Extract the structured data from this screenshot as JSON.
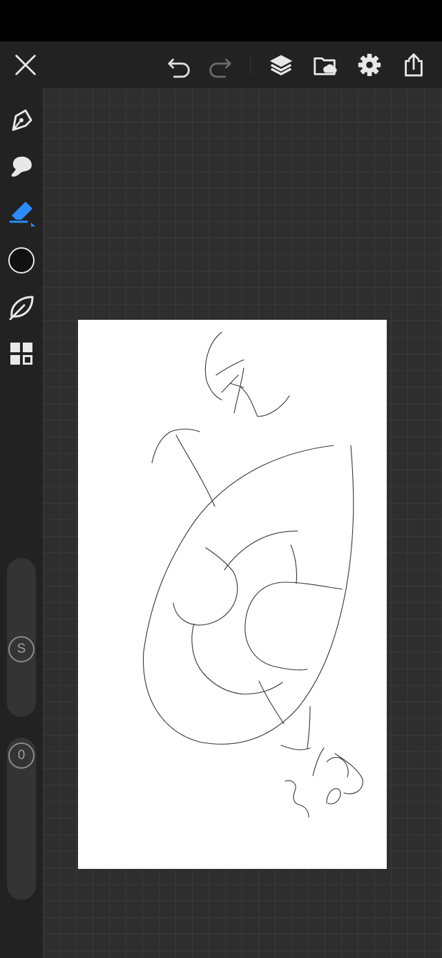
{
  "toolbar": {
    "close": "close-icon",
    "undo": "undo-icon",
    "redo": "redo-icon",
    "layers": "layers-icon",
    "gallery": "folder-cloud-icon",
    "settings": "gear-icon",
    "share": "share-icon"
  },
  "sidebar": {
    "tools": [
      "pen-icon",
      "smudge-icon",
      "eraser-icon",
      "color-icon",
      "leaf-icon",
      "grid-icon"
    ],
    "selected_tool": "eraser",
    "accent_color": "#2a8cff",
    "brush_color": "#111111"
  },
  "sliders": {
    "size_label": "S",
    "opacity_label": "0"
  },
  "canvas": {
    "background": "#ffffff",
    "grid_color": "#3a3a3a"
  }
}
